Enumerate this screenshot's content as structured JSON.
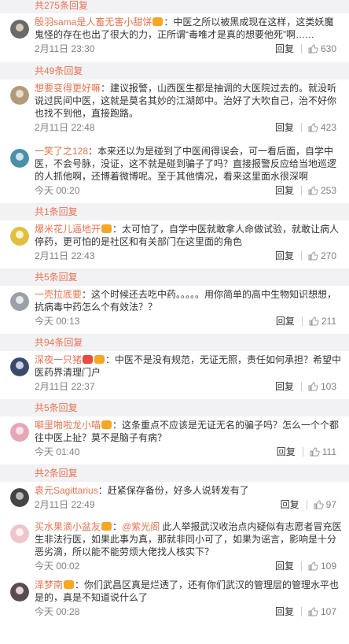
{
  "top_reply_band": "共275条回复",
  "reply_label": "回复",
  "comments": [
    {
      "user": "殷羽sama是人畜无害小甜饼",
      "text": "：中医之所以被黑成现在这样，这类妖魔鬼怪的存在也出了很大的力，正所谓“毒唯才是真的想要他死”啊……",
      "time": "2月11日 23:30",
      "likes": "630",
      "replies": "共49条回复"
    },
    {
      "user": "想要变得更好嘛",
      "text": "：建议报警，山西医生都是抽调的大医院过去的。就没听说过民间中医，这就是莫名其妙的江湖郎中。治好了大吹自己，治不好你也找不到他，直接跑路。",
      "time": "2月11日 22:48",
      "likes": "423",
      "replies": null
    },
    {
      "user": "一笑了之128",
      "text": "：本来还以为是碰到了中医闹得误会，可一看后面，自学中医，不会号脉，没证，这不就是碰到骗子了吗？直接报警反应给当地巡逻的人抓他啊，还博着微博呢。至于其他情况，看来这里面水很深啊",
      "time": "今天 00:20",
      "likes": "253",
      "replies": "共1条回复"
    },
    {
      "user": "爆米花儿逼地开",
      "text": "：太可怕了，自学中医就敢拿人命做试验，就敢让病人停药，更可怕的是社区和有关部门在这里面的角色",
      "time": "2月11日 22:43",
      "likes": "270",
      "replies": "共5条回复"
    },
    {
      "user": "一壳拉底要",
      "text": "：这个时候还去吃中药。。。。。用你简单的高中生物知识想想，抗病毒中药怎么个有效法？？",
      "time": "今天 00:13",
      "likes": "211",
      "replies": "共94条回复"
    },
    {
      "user": "深夜一只猪",
      "text": "：中医不是没有规范，无证无照，责任如何承担？希望中医药界清理门户",
      "time": "2月11日 22:37",
      "likes": "103",
      "replies": "共5条回复"
    },
    {
      "user": "噼里啪啦龙小喵",
      "text": "：这条重点不应该是无证无名的骗子吗？怎么一个个都往中医上扯？莫不是脑子有病？",
      "time": "今天 01:40",
      "likes": "111",
      "replies": "共2条回复"
    },
    {
      "user": "袁元Sagittarius",
      "text": "：赶紧保存备份，好多人说转发有了",
      "time": "2月11日 22:49",
      "likes": "97",
      "replies": null
    },
    {
      "user": "买水果滴小盆友",
      "mention": "@紫光阁",
      "text": " 此人举报武汉收治点内疑似有志愿者冒充医生非法行医，如果此事为真，那就非同小可了，如果为谣言，影响是十分恶劣滴，所以能不能劳烦大佬找人核实下？",
      "time": "今天 00:02",
      "likes": "109",
      "replies": null
    },
    {
      "user": "泽梦南",
      "text": "：你们武昌区真是烂透了，还有你们武汉的管理层的管理水平也是的，真是不知道说什么了",
      "time": "今天 00:28",
      "likes": "107",
      "replies": null
    }
  ],
  "colors": {
    "accent": "#eb7350",
    "band_bg": "#f2f2f5",
    "meta": "#808080"
  },
  "icons": {
    "like": "thumbs-up-icon",
    "vip": "vip-badge-icon"
  }
}
